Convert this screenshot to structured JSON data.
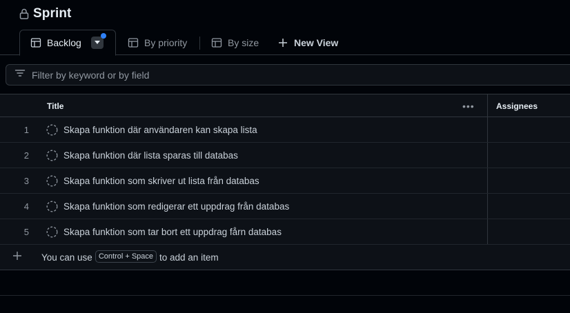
{
  "project": {
    "title": "Sprint",
    "icon": "lock-icon"
  },
  "tabs": [
    {
      "label": "Backlog",
      "icon": "table-icon",
      "active": true
    },
    {
      "label": "By priority",
      "icon": "table-icon"
    },
    {
      "label": "By size",
      "icon": "table-icon"
    }
  ],
  "new_view": {
    "label": "New View",
    "icon": "plus-icon"
  },
  "filter": {
    "placeholder": "Filter by keyword or by field",
    "icon": "filter-icon"
  },
  "table": {
    "columns": {
      "title": "Title",
      "assignees": "Assignees",
      "menu": "•••"
    },
    "rows": [
      {
        "num": "1",
        "title": "Skapa funktion där användaren kan skapa lista"
      },
      {
        "num": "2",
        "title": "Skapa funktion där lista sparas till databas"
      },
      {
        "num": "3",
        "title": "Skapa funktion som skriver ut lista från databas"
      },
      {
        "num": "4",
        "title": "Skapa funktion som redigerar ett uppdrag från databas"
      },
      {
        "num": "5",
        "title": "Skapa funktion som tar bort ett uppdrag fårn databas"
      }
    ],
    "add_item": {
      "prefix": "You can use",
      "shortcut": "Control + Space",
      "suffix": "to add an item"
    }
  },
  "colors": {
    "accent": "#2f81f7",
    "background": "#010409",
    "surface": "#0d1117",
    "border": "#30363d"
  }
}
